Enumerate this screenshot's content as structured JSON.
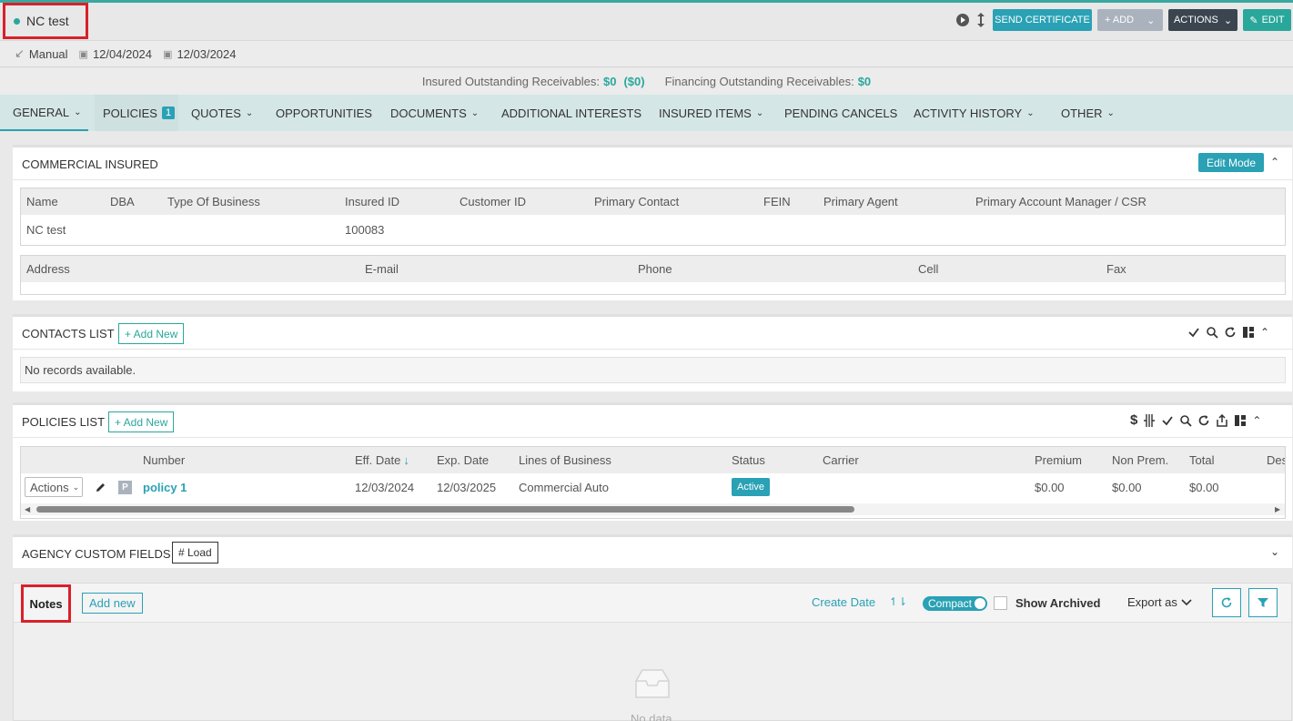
{
  "header": {
    "title": "NC test",
    "buttons": {
      "send_certificate": "SEND CERTIFICATE",
      "add": "+ ADD",
      "actions": "ACTIONS",
      "edit": "EDIT"
    }
  },
  "meta": {
    "type": "Manual",
    "date1": "12/04/2024",
    "date2": "12/03/2024"
  },
  "receivables": {
    "insured_label": "Insured Outstanding Receivables:",
    "insured_value": "$0",
    "insured_paren": "($0)",
    "financing_label": "Financing Outstanding Receivables:",
    "financing_value": "$0"
  },
  "tabs": {
    "general": "GENERAL",
    "policies": "POLICIES",
    "policies_count": "1",
    "quotes": "QUOTES",
    "opportunities": "OPPORTUNITIES",
    "documents": "DOCUMENTS",
    "additional_interests": "ADDITIONAL INTERESTS",
    "insured_items": "INSURED ITEMS",
    "pending_cancels": "PENDING CANCELS",
    "activity_history": "ACTIVITY HISTORY",
    "other": "OTHER"
  },
  "commercial": {
    "title": "COMMERCIAL INSURED",
    "edit_mode": "Edit Mode",
    "headers": [
      "Name",
      "DBA",
      "Type Of Business",
      "Insured ID",
      "Customer ID",
      "Primary Contact",
      "FEIN",
      "Primary Agent",
      "Primary Account Manager / CSR"
    ],
    "row": [
      "NC test",
      "",
      "",
      "100083",
      "",
      "",
      "",
      "",
      ""
    ],
    "headers2": [
      "Address",
      "E-mail",
      "Phone",
      "Cell",
      "Fax"
    ]
  },
  "contacts": {
    "title": "CONTACTS LIST",
    "add_new": "+ Add New",
    "empty": "No records available."
  },
  "policies": {
    "title": "POLICIES LIST",
    "add_new": "+ Add New",
    "headers": [
      "Number",
      "Eff. Date",
      "Exp. Date",
      "Lines of Business",
      "Status",
      "Carrier",
      "Premium",
      "Non Prem.",
      "Total",
      "Des"
    ],
    "row": {
      "actions": "Actions",
      "p_badge": "P",
      "number": "policy 1",
      "eff": "12/03/2024",
      "exp": "12/03/2025",
      "lob": "Commercial Auto",
      "status": "Active",
      "carrier": "",
      "premium": "$0.00",
      "nonprem": "$0.00",
      "total": "$0.00"
    }
  },
  "custom": {
    "title": "AGENCY CUSTOM FIELDS",
    "load": "# Load"
  },
  "notes": {
    "title": "Notes",
    "add_new": "Add new",
    "sort": "Create Date",
    "compact": "Compact",
    "show_archived": "Show Archived",
    "export": "Export as",
    "empty": "No data"
  },
  "colors": {
    "accent": "#2aa1b5",
    "green": "#2aa79b",
    "highlight": "#d9202a"
  }
}
